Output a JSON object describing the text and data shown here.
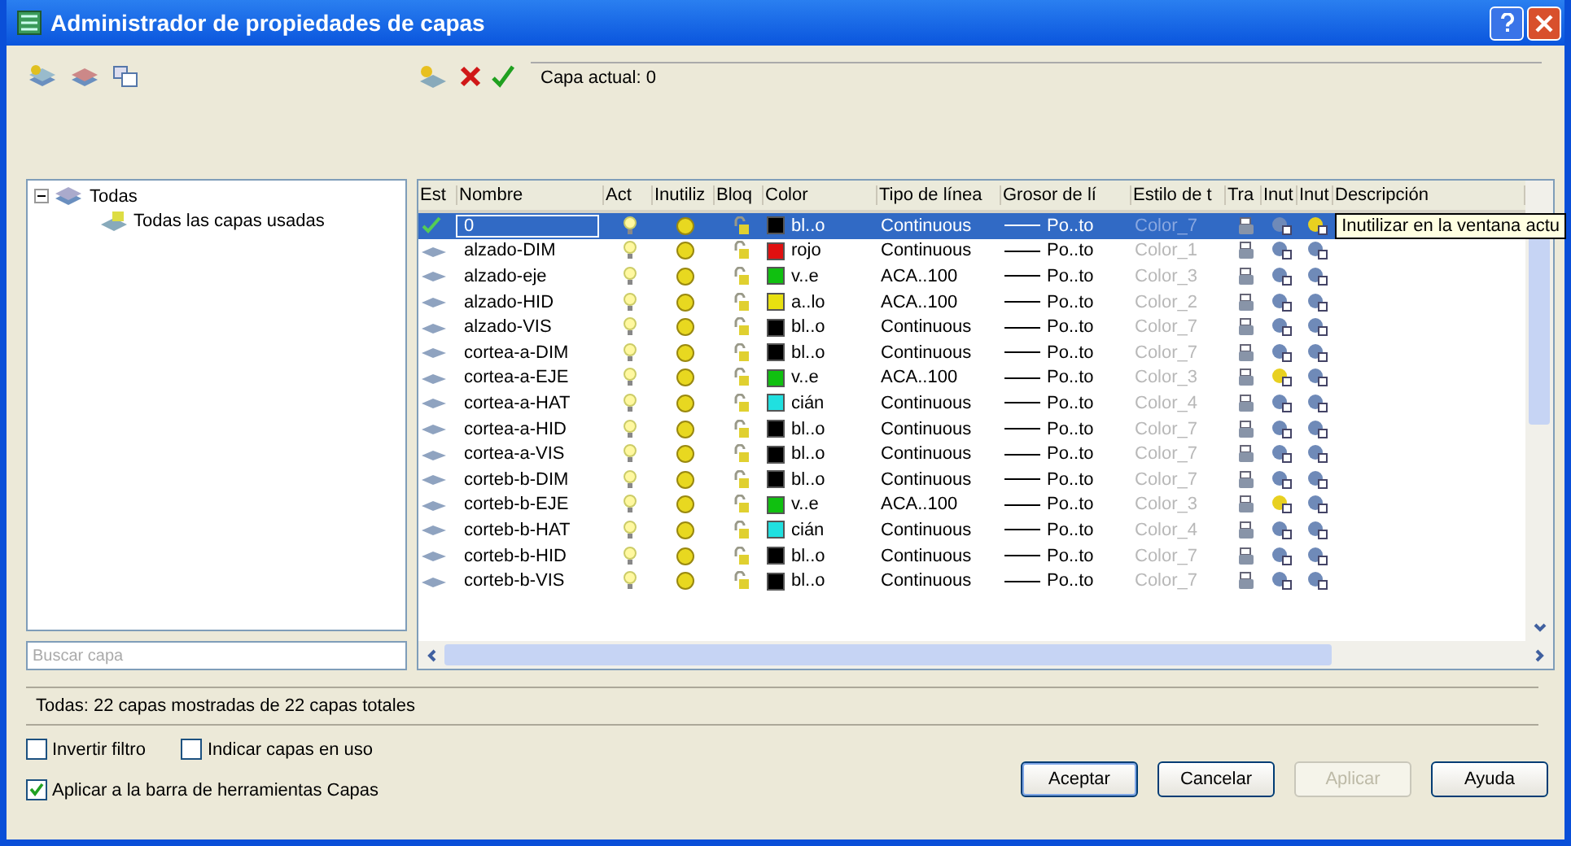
{
  "window": {
    "title": "Administrador de propiedades de capas"
  },
  "current_layer": "Capa actual: 0",
  "tree": {
    "label": "Todas",
    "expanded": true,
    "children": [
      {
        "label": "Todas las capas usadas"
      }
    ]
  },
  "search": {
    "placeholder": "Buscar capa"
  },
  "table": {
    "columns": [
      "Est",
      "Nombre",
      "Act",
      "Inutiliz",
      "Bloq",
      "Color",
      "Tipo de línea",
      "Grosor de lí",
      "Estilo de t",
      "Tra",
      "Inut",
      "Inut",
      "Descripción"
    ],
    "rows": [
      {
        "name": "0",
        "selected": true,
        "current": true,
        "color": "#000000",
        "color_name": "bl..o",
        "linetype": "Continuous",
        "lineweight": "Po..to",
        "plot_style": "Color_7",
        "vp_frozen": false
      },
      {
        "name": "alzado-DIM",
        "selected": false,
        "current": false,
        "color": "#e01010",
        "color_name": "rojo",
        "linetype": "Continuous",
        "lineweight": "Po..to",
        "plot_style": "Color_1",
        "vp_frozen": false
      },
      {
        "name": "alzado-eje",
        "selected": false,
        "current": false,
        "color": "#10c010",
        "color_name": "v..e",
        "linetype": "ACA..100",
        "lineweight": "Po..to",
        "plot_style": "Color_3",
        "vp_frozen": false
      },
      {
        "name": "alzado-HID",
        "selected": false,
        "current": false,
        "color": "#e8e010",
        "color_name": "a..lo",
        "linetype": "ACA..100",
        "lineweight": "Po..to",
        "plot_style": "Color_2",
        "vp_frozen": false
      },
      {
        "name": "alzado-VIS",
        "selected": false,
        "current": false,
        "color": "#000000",
        "color_name": "bl..o",
        "linetype": "Continuous",
        "lineweight": "Po..to",
        "plot_style": "Color_7",
        "vp_frozen": false
      },
      {
        "name": "cortea-a-DIM",
        "selected": false,
        "current": false,
        "color": "#000000",
        "color_name": "bl..o",
        "linetype": "Continuous",
        "lineweight": "Po..to",
        "plot_style": "Color_7",
        "vp_frozen": false
      },
      {
        "name": "cortea-a-EJE",
        "selected": false,
        "current": false,
        "color": "#10c010",
        "color_name": "v..e",
        "linetype": "ACA..100",
        "lineweight": "Po..to",
        "plot_style": "Color_3",
        "vp_frozen": true
      },
      {
        "name": "cortea-a-HAT",
        "selected": false,
        "current": false,
        "color": "#20e0e0",
        "color_name": "cián",
        "linetype": "Continuous",
        "lineweight": "Po..to",
        "plot_style": "Color_4",
        "vp_frozen": false
      },
      {
        "name": "cortea-a-HID",
        "selected": false,
        "current": false,
        "color": "#000000",
        "color_name": "bl..o",
        "linetype": "Continuous",
        "lineweight": "Po..to",
        "plot_style": "Color_7",
        "vp_frozen": false
      },
      {
        "name": "cortea-a-VIS",
        "selected": false,
        "current": false,
        "color": "#000000",
        "color_name": "bl..o",
        "linetype": "Continuous",
        "lineweight": "Po..to",
        "plot_style": "Color_7",
        "vp_frozen": false
      },
      {
        "name": "corteb-b-DIM",
        "selected": false,
        "current": false,
        "color": "#000000",
        "color_name": "bl..o",
        "linetype": "Continuous",
        "lineweight": "Po..to",
        "plot_style": "Color_7",
        "vp_frozen": false
      },
      {
        "name": "corteb-b-EJE",
        "selected": false,
        "current": false,
        "color": "#10c010",
        "color_name": "v..e",
        "linetype": "ACA..100",
        "lineweight": "Po..to",
        "plot_style": "Color_3",
        "vp_frozen": true
      },
      {
        "name": "corteb-b-HAT",
        "selected": false,
        "current": false,
        "color": "#20e0e0",
        "color_name": "cián",
        "linetype": "Continuous",
        "lineweight": "Po..to",
        "plot_style": "Color_4",
        "vp_frozen": false
      },
      {
        "name": "corteb-b-HID",
        "selected": false,
        "current": false,
        "color": "#000000",
        "color_name": "bl..o",
        "linetype": "Continuous",
        "lineweight": "Po..to",
        "plot_style": "Color_7",
        "vp_frozen": false
      },
      {
        "name": "corteb-b-VIS",
        "selected": false,
        "current": false,
        "color": "#000000",
        "color_name": "bl..o",
        "linetype": "Continuous",
        "lineweight": "Po..to",
        "plot_style": "Color_7",
        "vp_frozen": false
      }
    ]
  },
  "tooltip": "Inutilizar en la ventana actu",
  "status": "Todas: 22 capas mostradas de 22 capas totales",
  "options": [
    {
      "label": "Invertir filtro",
      "checked": false
    },
    {
      "label": "Indicar capas en uso",
      "checked": false
    },
    {
      "label": "Aplicar a la barra de herramientas Capas",
      "checked": true
    }
  ],
  "buttons": [
    {
      "label": "Aceptar",
      "disabled": false,
      "default": true
    },
    {
      "label": "Cancelar",
      "disabled": false,
      "default": false
    },
    {
      "label": "Aplicar",
      "disabled": true,
      "default": false
    },
    {
      "label": "Ayuda",
      "disabled": false,
      "default": false
    }
  ]
}
